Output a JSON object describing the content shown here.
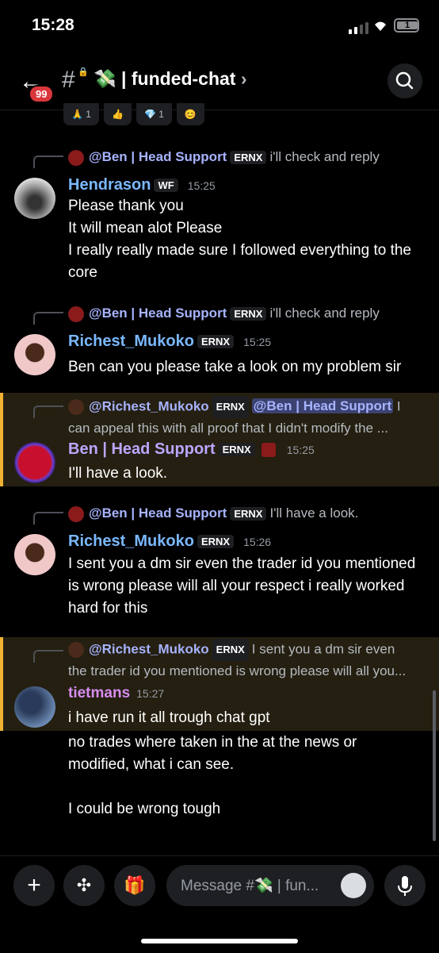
{
  "status": {
    "time": "15:28",
    "battery": "1"
  },
  "header": {
    "unread_badge": "99",
    "channel_emoji": "💸",
    "channel_name": "| funded-chat",
    "chevron": "›"
  },
  "reactions": [
    {
      "emoji": "🙏",
      "count": "1"
    },
    {
      "emoji": "👍",
      "count": ""
    },
    {
      "emoji": "💎",
      "count": "1"
    },
    {
      "emoji": "😊",
      "count": ""
    }
  ],
  "messages": [
    {
      "reply_to": "@Ben | Head Support",
      "reply_tag": "ERNX",
      "reply_text": "i'll check and reply",
      "author": "Hendrason",
      "author_tag": "WF",
      "time": "15:25",
      "lines": [
        "Please thank you",
        "It will mean alot Please",
        "I really really made sure I followed everything to the core"
      ]
    },
    {
      "reply_to": "@Ben | Head Support",
      "reply_tag": "ERNX",
      "reply_text": "i'll check and reply",
      "author": "Richest_Mukoko",
      "author_tag": "ERNX",
      "time": "15:25",
      "lines": [
        "Ben can you please take a look on my problem sir"
      ]
    },
    {
      "reply_to": "@Richest_Mukoko",
      "reply_tag": "ERNX",
      "reply_mention": "@Ben | Head Support",
      "reply_text": "I",
      "reply_text2": "can appeal this with all proof that I didn't modify the ...",
      "author": "Ben | Head Support",
      "author_tag": "ERNX",
      "time": "15:25",
      "lines": [
        "I'll have a look."
      ]
    },
    {
      "reply_to": "@Ben | Head Support",
      "reply_tag": "ERNX",
      "reply_text": "I'll have a look.",
      "author": "Richest_Mukoko",
      "author_tag": "ERNX",
      "time": "15:26",
      "lines": [
        "I sent you a dm sir even the trader id you mentioned is wrong please will all your respect i really worked hard for this"
      ]
    },
    {
      "reply_to": "@Richest_Mukoko",
      "reply_tag": "ERNX",
      "reply_text": "I sent you a dm sir even",
      "reply_text2": "the trader id you mentioned is wrong please will all you...",
      "author": "tietmans",
      "time": "15:27",
      "lines": [
        "i have run it all trough chat gpt"
      ]
    }
  ],
  "followup": {
    "line1": "no trades where taken in the at the news or modified, what i can see.",
    "line2": "I could be wrong tough"
  },
  "composer": {
    "placeholder": "Message #💸 | fun..."
  },
  "colors": {
    "highlight_border": "#f0b232",
    "mention": "#a7b3ff",
    "link_name": "#7ab8ff",
    "ben_name": "#b9a7ff",
    "tietmans_name": "#d78cf0"
  }
}
